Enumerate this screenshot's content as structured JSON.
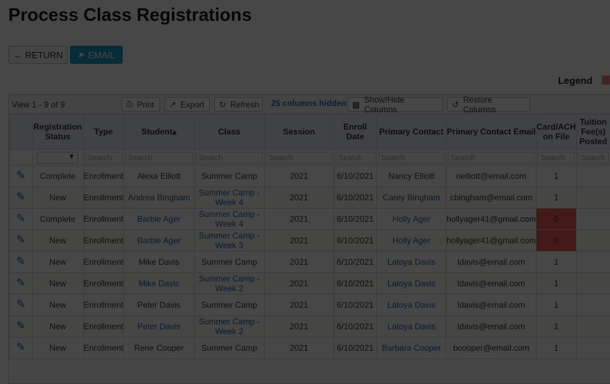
{
  "page_title": "Process Class Registrations",
  "buttons": {
    "return_label": "RETURN",
    "email_label": "EMAIL"
  },
  "legend_label": "Legend",
  "colors": {
    "email_button": "#1aa0c8",
    "legend_swatch": "#f07d7d",
    "alert_cell": "#f25c5c",
    "link": "#1f5fb0"
  },
  "toolbar": {
    "view_count": "View 1 - 9 of 9",
    "print": "Print",
    "export": "Export",
    "refresh": "Refresh",
    "hidden_count": "25 columns hidden",
    "show_hide": "Show/Hide Columns",
    "restore": "Restore Columns"
  },
  "columns": [
    "",
    "Registration Status",
    "Type",
    "Student",
    "Class",
    "Session",
    "Enroll Date",
    "Primary Contact",
    "Primary Contact Email",
    "Card/ACH on File",
    "Tuition Fee(s) Posted"
  ],
  "search_placeholder": "Search",
  "rows": [
    {
      "status": "Complete",
      "type": "Enrollment",
      "student": "Alexa Elliott",
      "class": "Summer Camp",
      "session": "2021",
      "date": "6/10/2021",
      "contact": "Nancy Elliott",
      "email": "nelliott@email.com",
      "card": "1",
      "tuition": ""
    },
    {
      "status": "New",
      "type": "Enrollment",
      "student": "Andrea Bingham",
      "class": "Summer Camp - Week 4",
      "session": "2021",
      "date": "6/10/2021",
      "contact": "Carey Bingham",
      "email": "cbingham@email.com",
      "card": "1",
      "tuition": ""
    },
    {
      "status": "Complete",
      "type": "Enrollment",
      "student": "Barbie Ager",
      "class": "Summer Camp - Week 4",
      "session": "2021",
      "date": "6/10/2021",
      "contact": "Holly Ager",
      "email": "hollyager41@gmail.com",
      "card": "0",
      "tuition": ""
    },
    {
      "status": "New",
      "type": "Enrollment",
      "student": "Barbie Ager",
      "class": "Summer Camp - Week 3",
      "session": "2021",
      "date": "6/10/2021",
      "contact": "Holly Ager",
      "email": "hollyager41@gmail.com",
      "card": "0",
      "tuition": ""
    },
    {
      "status": "New",
      "type": "Enrollment",
      "student": "Mike Davis",
      "class": "Summer Camp",
      "session": "2021",
      "date": "6/10/2021",
      "contact": "Latoya Davis",
      "email": "ldavis@email.com",
      "card": "1",
      "tuition": ""
    },
    {
      "status": "New",
      "type": "Enrollment",
      "student": "Mike Davis",
      "class": "Summer Camp - Week 2",
      "session": "2021",
      "date": "6/10/2021",
      "contact": "Latoya Davis",
      "email": "ldavis@email.com",
      "card": "1",
      "tuition": ""
    },
    {
      "status": "New",
      "type": "Enrollment",
      "student": "Peter Davis",
      "class": "Summer Camp",
      "session": "2021",
      "date": "6/10/2021",
      "contact": "Latoya Davis",
      "email": "ldavis@email.com",
      "card": "1",
      "tuition": ""
    },
    {
      "status": "New",
      "type": "Enrollment",
      "student": "Peter Davis",
      "class": "Summer Camp - Week 2",
      "session": "2021",
      "date": "6/10/2021",
      "contact": "Latoya Davis",
      "email": "ldavis@email.com",
      "card": "1",
      "tuition": ""
    },
    {
      "status": "New",
      "type": "Enrollment",
      "student": "Rene Cooper",
      "class": "Summer Camp",
      "session": "2021",
      "date": "6/10/2021",
      "contact": "Barbara Cooper",
      "email": "bcooper@email.com",
      "card": "1",
      "tuition": ""
    }
  ]
}
